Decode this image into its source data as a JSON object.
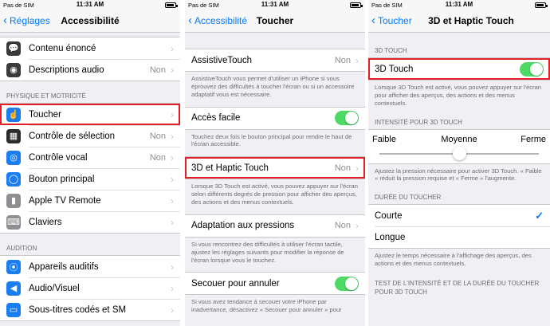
{
  "status": {
    "carrier": "Pas de SIM",
    "time": "11:31 AM"
  },
  "screen1": {
    "back": "Réglages",
    "title": "Accessibilité",
    "top_items": [
      {
        "label": "Contenu énoncé",
        "value": "",
        "icon": "speech-bubble-icon",
        "color": "#3a3a3c"
      },
      {
        "label": "Descriptions audio",
        "value": "Non",
        "icon": "audio-description-icon",
        "color": "#3a3a3c"
      }
    ],
    "section_physique": "PHYSIQUE ET MOTRICITÉ",
    "physique_items": [
      {
        "label": "Toucher",
        "value": "",
        "icon": "hand-icon",
        "color": "#1a7df0",
        "highlight": true
      },
      {
        "label": "Contrôle de sélection",
        "value": "Non",
        "icon": "switch-grid-icon",
        "color": "#2c2c2e"
      },
      {
        "label": "Contrôle vocal",
        "value": "Non",
        "icon": "voice-control-icon",
        "color": "#1a7df0"
      },
      {
        "label": "Bouton principal",
        "value": "",
        "icon": "home-button-icon",
        "color": "#1a7df0"
      },
      {
        "label": "Apple TV Remote",
        "value": "",
        "icon": "remote-icon",
        "color": "#8e8e93"
      },
      {
        "label": "Claviers",
        "value": "",
        "icon": "keyboard-icon",
        "color": "#8e8e93"
      }
    ],
    "section_audition": "AUDITION",
    "audition_items": [
      {
        "label": "Appareils auditifs",
        "value": "",
        "icon": "ear-icon",
        "color": "#1a7df0"
      },
      {
        "label": "Audio/Visuel",
        "value": "",
        "icon": "speaker-icon",
        "color": "#1a7df0"
      },
      {
        "label": "Sous-titres codés et SM",
        "value": "",
        "icon": "captions-icon",
        "color": "#1a7df0"
      }
    ]
  },
  "screen2": {
    "back": "Accessibilité",
    "title": "Toucher",
    "assistive": {
      "label": "AssistiveTouch",
      "value": "Non",
      "footer": "AssistiveTouch vous permet d'utiliser un iPhone si vous éprouvez des difficultés à toucher l'écran ou si un accessoire adaptatif vous est nécessaire."
    },
    "acces_facile": {
      "label": "Accès facile",
      "footer": "Touchez deux fois le bouton principal pour rendre le haut de l'écran accessible."
    },
    "haptic": {
      "label": "3D et Haptic Touch",
      "value": "Non",
      "footer": "Lorsque 3D Touch est activé, vous pouvez appuyer sur l'écran selon différents degrés de pression pour afficher des aperçus, des actions et des menus contextuels."
    },
    "adaptation": {
      "label": "Adaptation aux pressions",
      "value": "Non",
      "footer": "Si vous rencontrez des difficultés à utiliser l'écran tactile, ajustez les réglages suivants pour modifier la réponse de l'écran lorsque vous le touchez."
    },
    "secouer": {
      "label": "Secouer pour annuler",
      "footer": "Si vous avez tendance à secouer votre iPhone par inadvertance, désactivez « Secouer pour annuler » pour"
    }
  },
  "screen3": {
    "back": "Toucher",
    "title": "3D et Haptic Touch",
    "section_3d": "3D TOUCH",
    "touch3d": {
      "label": "3D Touch",
      "footer": "Lorsque 3D Touch est activé, vous pouvez appuyer sur l'écran pour afficher des aperçus, des actions et des menus contextuels."
    },
    "section_intensite": "INTENSITÉ POUR 3D TOUCH",
    "slider": {
      "low": "Faible",
      "mid": "Moyenne",
      "high": "Ferme",
      "level": 0.5
    },
    "slider_footer": "Ajustez la pression nécessaire pour activer 3D Touch. « Faible » réduit la pression requise et « Ferme » l'augmente.",
    "section_duree": "DURÉE DU TOUCHER",
    "duree_options": [
      {
        "label": "Courte",
        "selected": true
      },
      {
        "label": "Longue",
        "selected": false
      }
    ],
    "duree_footer": "Ajustez le temps nécessaire à l'affichage des aperçus, des actions et des menus contextuels.",
    "section_test": "TEST DE L'INTENSITÉ ET DE LA DURÉE DU TOUCHER POUR 3D TOUCH"
  }
}
